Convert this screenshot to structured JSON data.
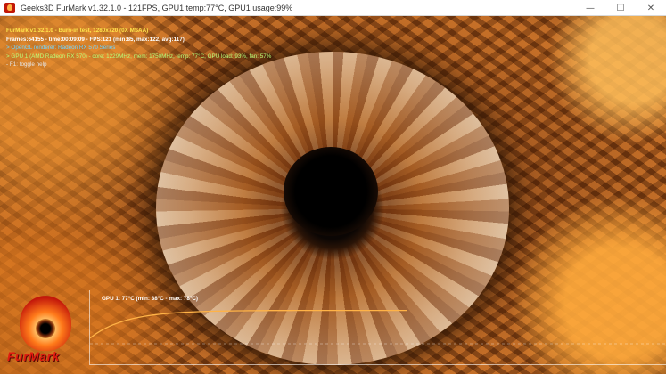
{
  "window": {
    "title": "Geeks3D FurMark v1.32.1.0 - 121FPS, GPU1 temp:77°C, GPU1 usage:99%",
    "icon": "furmark-app-icon",
    "controls": {
      "minimize": "—",
      "maximize": "☐",
      "close": "✕"
    }
  },
  "overlay": {
    "lines": [
      "FurMark v1.32.1.0 - Burn-in test, 1280x720 (0X MSAA)",
      "Frames:64155 - time:00:09:09 - FPS:121 (min:85, max:122, avg:117)",
      "> OpenGL renderer: Radeon RX 570 Series",
      "> GPU 1 (AMD Radeon RX 570) - core: 1229MHz, mem: 1750MHz, temp: 77°C, GPU load: 93%, fan: 57%",
      "- F1: toggle help"
    ]
  },
  "temp_graph": {
    "label": "GPU 1: 77°C (min: 38°C - max: 78°C)",
    "current_c": 77,
    "min_c": 38,
    "max_c": 78,
    "line_color": "#ffb347"
  },
  "logo": {
    "text": "FurMark"
  }
}
